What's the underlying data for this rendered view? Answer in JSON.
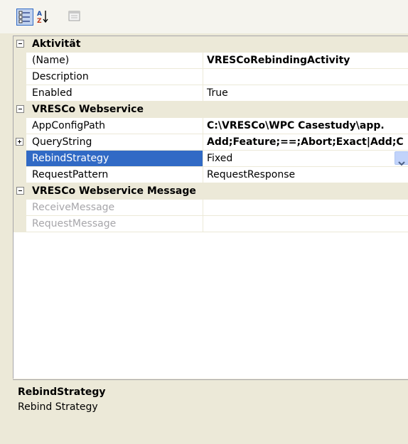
{
  "toolbar": {
    "buttons": [
      {
        "name": "categorized-icon",
        "active": true
      },
      {
        "name": "sort-alphabetical-icon",
        "active": false
      },
      {
        "name": "property-pages-icon",
        "active": false
      }
    ]
  },
  "categories": [
    {
      "label": "Aktivität",
      "expanded": true,
      "properties": [
        {
          "name": "(Name)",
          "value": "VRESCoRebindingActivity",
          "bold": true
        },
        {
          "name": "Description",
          "value": ""
        },
        {
          "name": "Enabled",
          "value": "True"
        }
      ]
    },
    {
      "label": "VRESCo Webservice",
      "expanded": true,
      "properties": [
        {
          "name": "AppConfigPath",
          "value": "C:\\VRESCo\\WPC Casestudy\\app.",
          "bold": true
        },
        {
          "name": "QueryString",
          "value": "Add;Feature;==;Abort;Exact|Add;C",
          "bold": true,
          "expandable": true
        },
        {
          "name": "RebindStrategy",
          "value": "Fixed",
          "selected": true,
          "dropdown": true
        },
        {
          "name": "RequestPattern",
          "value": "RequestResponse"
        }
      ]
    },
    {
      "label": "VRESCo Webservice Message",
      "expanded": true,
      "properties": [
        {
          "name": "ReceiveMessage",
          "value": "",
          "disabled": true
        },
        {
          "name": "RequestMessage",
          "value": "",
          "disabled": true
        }
      ]
    }
  ],
  "description": {
    "title": "RebindStrategy",
    "text": "Rebind Strategy"
  },
  "colors": {
    "selection": "#316ac5",
    "category_bg": "#ece9d8",
    "disabled_text": "#a7a6aa"
  }
}
